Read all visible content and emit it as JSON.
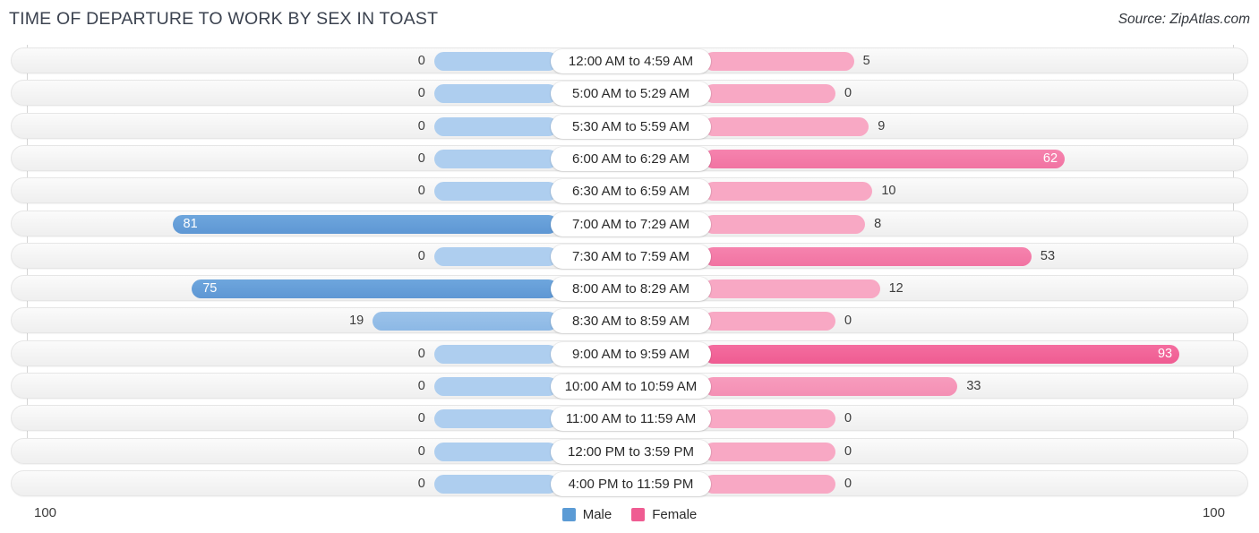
{
  "header": {
    "title": "TIME OF DEPARTURE TO WORK BY SEX IN TOAST",
    "source": "Source: ZipAtlas.com"
  },
  "axis": {
    "left_label": "100",
    "right_label": "100",
    "max": 100
  },
  "legend": {
    "items": [
      {
        "label": "Male",
        "color": "#5b9bd5",
        "name": "legend-male"
      },
      {
        "label": "Female",
        "color": "#ef5c92",
        "name": "legend-female"
      }
    ]
  },
  "colors": {
    "male_light": "#aeceef",
    "male_mid": "#8cb8e5",
    "male_high": "#5e97d4",
    "female_light": "#f8a8c4",
    "female_midlo": "#f48fb4",
    "female_mid": "#f173a2",
    "female_high": "#ef5c92",
    "track": "#f4f4f4",
    "gridline": "#d5d5d5",
    "title": "#3c4350"
  },
  "chart_data": {
    "type": "bar",
    "orientation": "horizontal",
    "style": "diverging-bidirectional",
    "title": "TIME OF DEPARTURE TO WORK BY SEX IN TOAST",
    "xlabel": "",
    "ylabel": "",
    "xlim": [
      0,
      100
    ],
    "grid": false,
    "legend_position": "bottom-center",
    "categories": [
      "12:00 AM to 4:59 AM",
      "5:00 AM to 5:29 AM",
      "5:30 AM to 5:59 AM",
      "6:00 AM to 6:29 AM",
      "6:30 AM to 6:59 AM",
      "7:00 AM to 7:29 AM",
      "7:30 AM to 7:59 AM",
      "8:00 AM to 8:29 AM",
      "8:30 AM to 8:59 AM",
      "9:00 AM to 9:59 AM",
      "10:00 AM to 10:59 AM",
      "11:00 AM to 11:59 AM",
      "12:00 PM to 3:59 PM",
      "4:00 PM to 11:59 PM"
    ],
    "series": [
      {
        "name": "Male",
        "color": "#5b9bd5",
        "values": [
          0,
          0,
          0,
          0,
          0,
          81,
          0,
          75,
          19,
          0,
          0,
          0,
          0,
          0
        ]
      },
      {
        "name": "Female",
        "color": "#ef5c92",
        "values": [
          5,
          0,
          9,
          62,
          10,
          8,
          53,
          12,
          0,
          93,
          33,
          0,
          0,
          0
        ]
      }
    ]
  },
  "rows": [
    {
      "label": "12:00 AM to 4:59 AM",
      "male": 0,
      "female": 5,
      "male_label": "0",
      "female_label": "5"
    },
    {
      "label": "5:00 AM to 5:29 AM",
      "male": 0,
      "female": 0,
      "male_label": "0",
      "female_label": "0"
    },
    {
      "label": "5:30 AM to 5:59 AM",
      "male": 0,
      "female": 9,
      "male_label": "0",
      "female_label": "9"
    },
    {
      "label": "6:00 AM to 6:29 AM",
      "male": 0,
      "female": 62,
      "male_label": "0",
      "female_label": "62"
    },
    {
      "label": "6:30 AM to 6:59 AM",
      "male": 0,
      "female": 10,
      "male_label": "0",
      "female_label": "10"
    },
    {
      "label": "7:00 AM to 7:29 AM",
      "male": 81,
      "female": 8,
      "male_label": "81",
      "female_label": "8"
    },
    {
      "label": "7:30 AM to 7:59 AM",
      "male": 0,
      "female": 53,
      "male_label": "0",
      "female_label": "53"
    },
    {
      "label": "8:00 AM to 8:29 AM",
      "male": 75,
      "female": 12,
      "male_label": "75",
      "female_label": "12"
    },
    {
      "label": "8:30 AM to 8:59 AM",
      "male": 19,
      "female": 0,
      "male_label": "19",
      "female_label": "0"
    },
    {
      "label": "9:00 AM to 9:59 AM",
      "male": 0,
      "female": 93,
      "male_label": "0",
      "female_label": "93"
    },
    {
      "label": "10:00 AM to 10:59 AM",
      "male": 0,
      "female": 33,
      "male_label": "0",
      "female_label": "33"
    },
    {
      "label": "11:00 AM to 11:59 AM",
      "male": 0,
      "female": 0,
      "male_label": "0",
      "female_label": "0"
    },
    {
      "label": "12:00 PM to 3:59 PM",
      "male": 0,
      "female": 0,
      "male_label": "0",
      "female_label": "0"
    },
    {
      "label": "4:00 PM to 11:59 PM",
      "male": 0,
      "female": 0,
      "male_label": "0",
      "female_label": "0"
    }
  ]
}
